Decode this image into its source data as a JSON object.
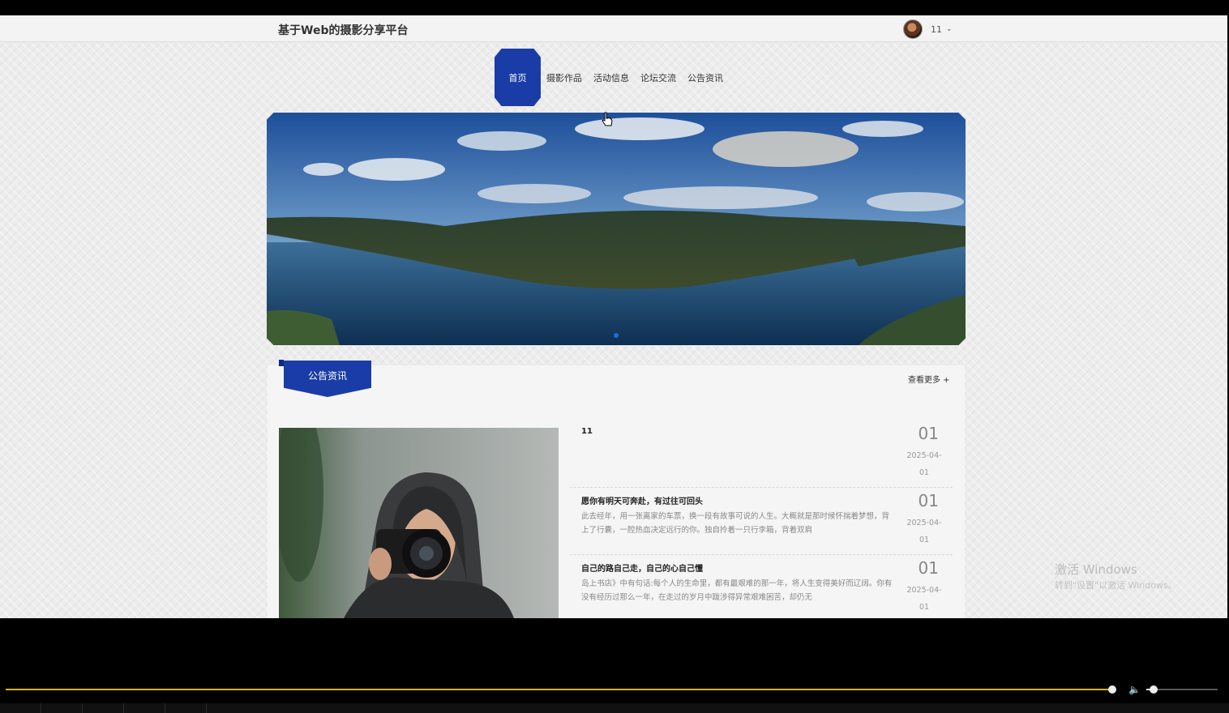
{
  "header": {
    "site_title": "基于Web的摄影分享平台",
    "user_name": "11"
  },
  "nav": {
    "items": [
      "首页",
      "摄影作品",
      "活动信息",
      "论坛交流",
      "公告资讯"
    ]
  },
  "notice": {
    "section_title": "公告资讯",
    "more_label": "查看更多 +",
    "items": [
      {
        "title": "11",
        "desc": "",
        "day": "01",
        "date": "2025-04-01"
      },
      {
        "title": "愿你有明天可奔赴，有过往可回头",
        "desc": "此去经年，用一张离家的车票，换一段有故事可说的人生。大概就是那时候怀揣着梦想，背上了行囊，一腔热血决定远行的你。独自拎着一只行李箱，背着双肩",
        "day": "01",
        "date": "2025-04-01"
      },
      {
        "title": "自己的路自己走，自己的心自己懂",
        "desc": "岛上书店》中有句话:每个人的生命里，都有最艰难的那一年，将人生变得美好而辽阔。你有没有经历过那么一年，在走过的岁月中跋涉得异常艰难困苦，却仍无",
        "day": "01",
        "date": "2025-04-01"
      }
    ]
  },
  "watermark": {
    "line1": "激活 Windows",
    "line2": "转到\"设置\"以激活 Windows。"
  },
  "player": {
    "progress": 0.99,
    "volume": 0.1
  },
  "colors": {
    "accent": "#1a3ca6",
    "progress": "#d8b600"
  }
}
